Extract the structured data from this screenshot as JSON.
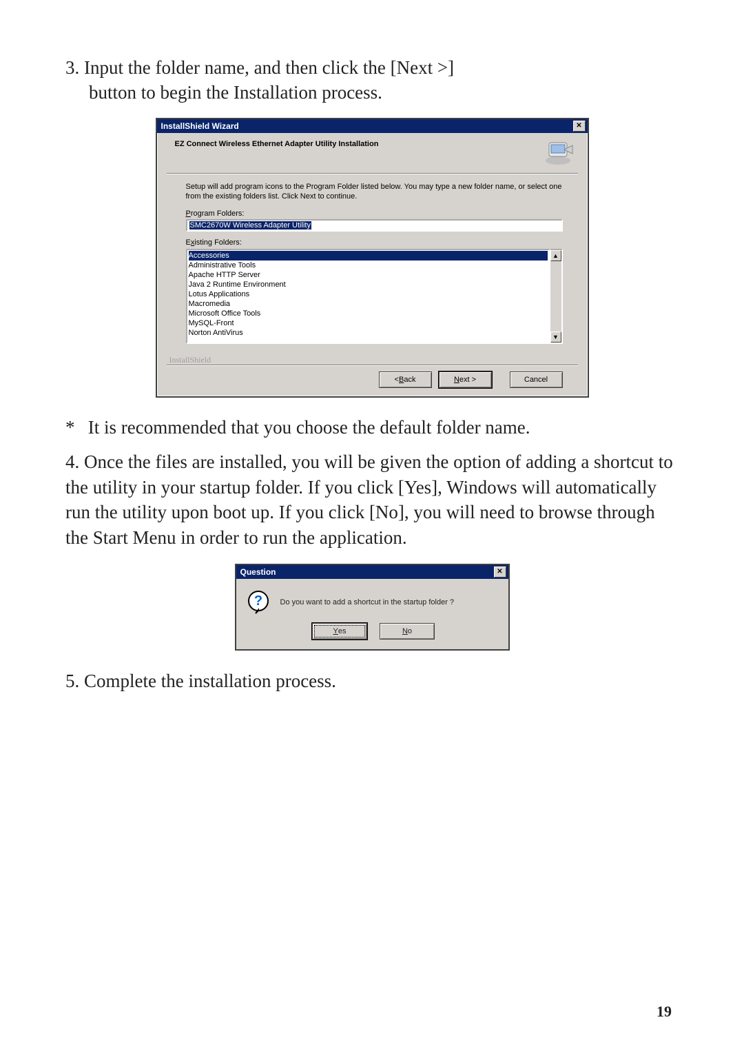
{
  "step3": {
    "num": "3.",
    "line1": "Input the folder name, and then click the [Next >]",
    "line2": "button to begin the Installation process."
  },
  "wizard": {
    "title": "InstallShield Wizard",
    "header": "EZ Connect Wireless Ethernet Adapter Utility Installation",
    "desc": "Setup will add program icons to the Program Folder listed below.  You may type a new folder name, or select one from the existing folders list.  Click Next to continue.",
    "program_label_u": "P",
    "program_label_rest": "rogram Folders:",
    "program_value": "SMC2670W Wireless Adapter Utility",
    "existing_label_u": "x",
    "existing_label_pre": "E",
    "existing_label_post": "isting Folders:",
    "folders": [
      "Accessories",
      "Administrative Tools",
      "Apache HTTP Server",
      "Java 2 Runtime Environment",
      "Lotus Applications",
      "Macromedia",
      "Microsoft Office Tools",
      "MySQL-Front",
      "Norton AntiVirus"
    ],
    "group_label": "InstallShield",
    "back_u": "B",
    "back_pre": "< ",
    "back_post": "ack",
    "next_u": "N",
    "next_post": "ext >",
    "cancel": "Cancel"
  },
  "note": {
    "ast": "*",
    "text": "It is recommended that you choose the default folder name."
  },
  "step4": {
    "num": "4.",
    "text": "Once the files are installed, you will be given the option of adding a shortcut to the utility in your startup folder. If you click [Yes], Windows will automatically run the utility upon boot up. If you click [No], you will need to browse through the Start Menu in order to run the application."
  },
  "question": {
    "title": "Question",
    "text": "Do you want to add a shortcut in the startup folder ?",
    "yes_u": "Y",
    "yes_post": "es",
    "no_u": "N",
    "no_post": "o"
  },
  "step5": {
    "num": "5.",
    "text": "Complete the installation process."
  },
  "page_number": "19"
}
